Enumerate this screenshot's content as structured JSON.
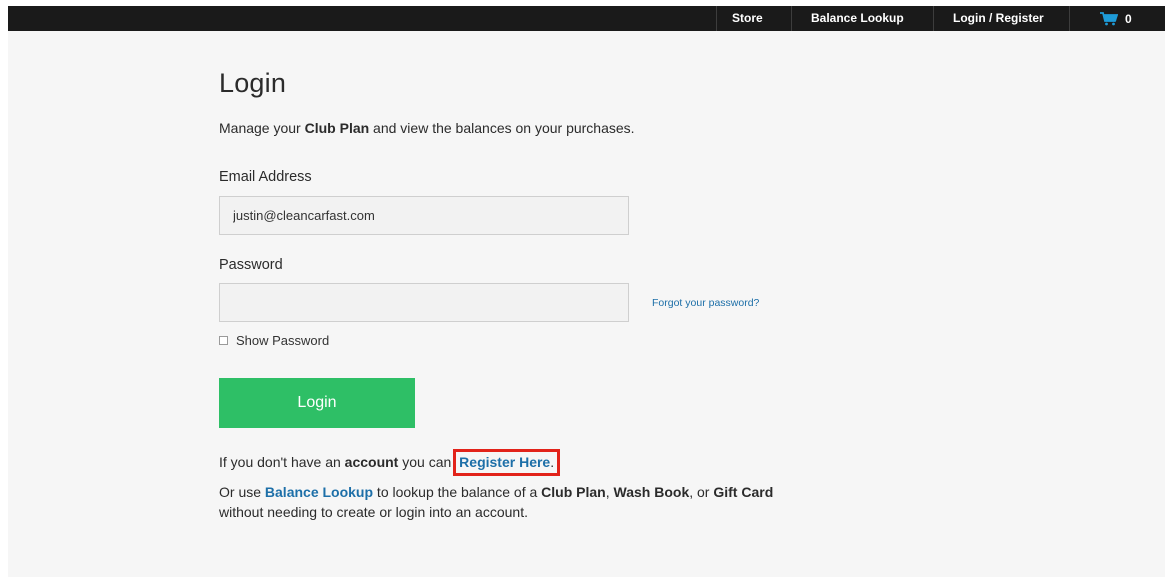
{
  "nav": {
    "store_label": "Store",
    "balance_label": "Balance Lookup",
    "login_label": "Login / Register",
    "cart_icon": "shopping-cart-icon",
    "cart_count": "0"
  },
  "page": {
    "title": "Login",
    "intro_prefix": "Manage your ",
    "intro_bold": "Club Plan",
    "intro_suffix": " and view the balances on your purchases."
  },
  "form": {
    "email_label": "Email Address",
    "email_value": "justin@cleancarfast.com",
    "password_label": "Password",
    "password_value": "",
    "forgot_label": "Forgot your password?",
    "show_password_label": "Show Password",
    "show_password_checked": false,
    "login_button": "Login"
  },
  "register": {
    "prefix": "If you don't have an ",
    "bold": "account",
    "middle": " you can ",
    "link": "Register Here",
    "suffix": "."
  },
  "balance_info": {
    "prefix": "Or use ",
    "link": "Balance Lookup",
    "middle1": " to lookup the balance of a ",
    "item1": "Club Plan",
    "sep1": ", ",
    "item2": "Wash Book",
    "sep2": ", or ",
    "item3": "Gift Card",
    "line2": "without needing to create or login into an account."
  },
  "colors": {
    "topbar": "#1a1a1a",
    "accent_green": "#2ebf66",
    "link_blue": "#1d6fa8",
    "highlight_red": "#e2231a",
    "cart_blue": "#1e9bd7"
  }
}
